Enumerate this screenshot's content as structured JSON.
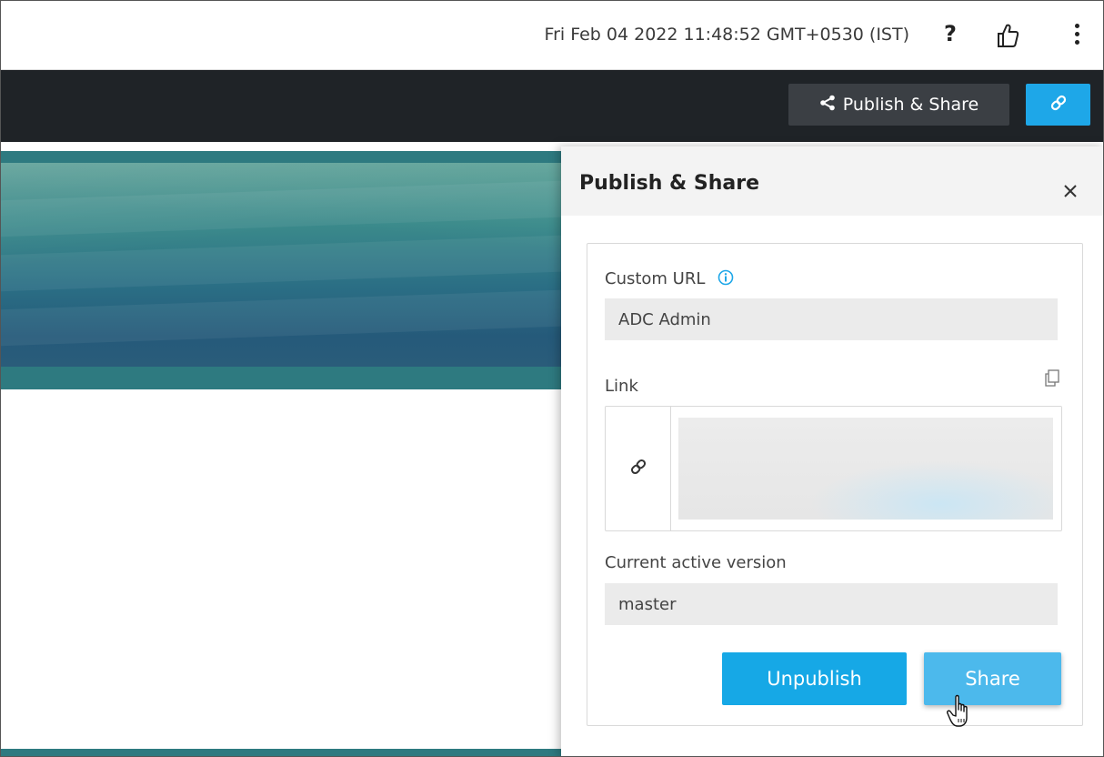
{
  "topbar": {
    "datetime": "Fri Feb 04 2022 11:48:52 GMT+0530 (IST)",
    "help_label": "?",
    "icons": [
      "help-icon",
      "thumbs-up-icon",
      "kebab-menu-icon"
    ]
  },
  "toolbar": {
    "publish_share_label": "Publish & Share",
    "icons": [
      "share-icon",
      "link-icon"
    ]
  },
  "panel": {
    "title": "Publish & Share",
    "custom_url": {
      "label": "Custom URL",
      "value": "ADC Admin"
    },
    "link": {
      "label": "Link"
    },
    "active_version": {
      "label": "Current active version",
      "value": "master"
    },
    "buttons": {
      "unpublish": "Unpublish",
      "share": "Share"
    }
  },
  "colors": {
    "toolbar_bg": "#1f2327",
    "accent_blue": "#1ea7e8",
    "share_button": "#4cb9ec",
    "banner_teal": "#2e7a80"
  }
}
